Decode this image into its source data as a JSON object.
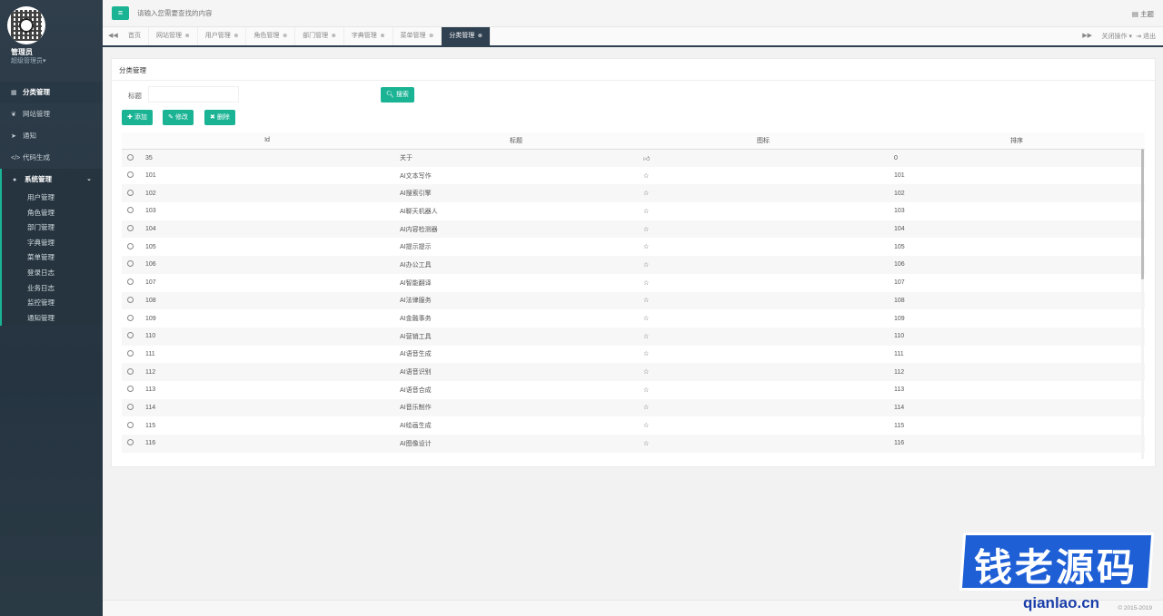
{
  "sidebar": {
    "user_name": "管理员",
    "user_role": "超级管理员▾",
    "items": [
      {
        "label": "分类管理",
        "icon": "grid-icon",
        "active": true
      },
      {
        "label": "网站管理",
        "icon": "leaf-icon"
      },
      {
        "label": "通知",
        "icon": "paper-plane-icon"
      },
      {
        "label": "代码生成",
        "icon": "code-icon"
      }
    ],
    "system_group": {
      "label": "系统管理",
      "icon": "user-icon",
      "items": [
        "用户管理",
        "角色管理",
        "部门管理",
        "字典管理",
        "菜单管理",
        "登录日志",
        "业务日志",
        "监控管理",
        "通知管理"
      ]
    }
  },
  "topbar": {
    "search_placeholder": "请输入您需要查找的内容",
    "theme_label": "主题"
  },
  "tabs": {
    "items": [
      "首页",
      "网站管理",
      "用户管理",
      "角色管理",
      "部门管理",
      "字典管理",
      "菜单管理",
      "分类管理"
    ],
    "active_index": 7,
    "close_ops": "关闭操作",
    "logout": "退出"
  },
  "main": {
    "panel_title": "分类管理",
    "filter_label": "标题",
    "search_button": "搜索",
    "add_button": "添加",
    "edit_button": "修改",
    "delete_button": "删除",
    "columns": [
      "Id",
      "标题",
      "图标",
      "排序"
    ],
    "rows": [
      {
        "id": "35",
        "title": "关于",
        "icon": "thumbs-up",
        "sort": "0"
      },
      {
        "id": "101",
        "title": "AI文本写作",
        "icon": "star",
        "sort": "101"
      },
      {
        "id": "102",
        "title": "AI搜索引擎",
        "icon": "star",
        "sort": "102"
      },
      {
        "id": "103",
        "title": "AI聊天机器人",
        "icon": "star",
        "sort": "103"
      },
      {
        "id": "104",
        "title": "AI内容检测器",
        "icon": "star",
        "sort": "104"
      },
      {
        "id": "105",
        "title": "AI提示提示",
        "icon": "star",
        "sort": "105"
      },
      {
        "id": "106",
        "title": "AI办公工具",
        "icon": "star",
        "sort": "106"
      },
      {
        "id": "107",
        "title": "AI智能翻译",
        "icon": "star",
        "sort": "107"
      },
      {
        "id": "108",
        "title": "AI法律服务",
        "icon": "star",
        "sort": "108"
      },
      {
        "id": "109",
        "title": "AI金融事务",
        "icon": "star",
        "sort": "109"
      },
      {
        "id": "110",
        "title": "AI营销工具",
        "icon": "star",
        "sort": "110"
      },
      {
        "id": "111",
        "title": "AI语音生成",
        "icon": "star",
        "sort": "111"
      },
      {
        "id": "112",
        "title": "AI语音识别",
        "icon": "star",
        "sort": "112"
      },
      {
        "id": "113",
        "title": "AI语音合成",
        "icon": "star",
        "sort": "113"
      },
      {
        "id": "114",
        "title": "AI音乐制作",
        "icon": "star",
        "sort": "114"
      },
      {
        "id": "115",
        "title": "AI绘画生成",
        "icon": "star",
        "sort": "115"
      },
      {
        "id": "116",
        "title": "AI图像设计",
        "icon": "star",
        "sort": "116"
      }
    ]
  },
  "footer": {
    "copyright": "© 2015-2019"
  },
  "watermark": {
    "text": "钱老源码",
    "url": "qianlao.cn"
  },
  "colors": {
    "accent": "#1ab394",
    "sidebar": "#2f4050",
    "watermark": "#1e5fd6"
  }
}
